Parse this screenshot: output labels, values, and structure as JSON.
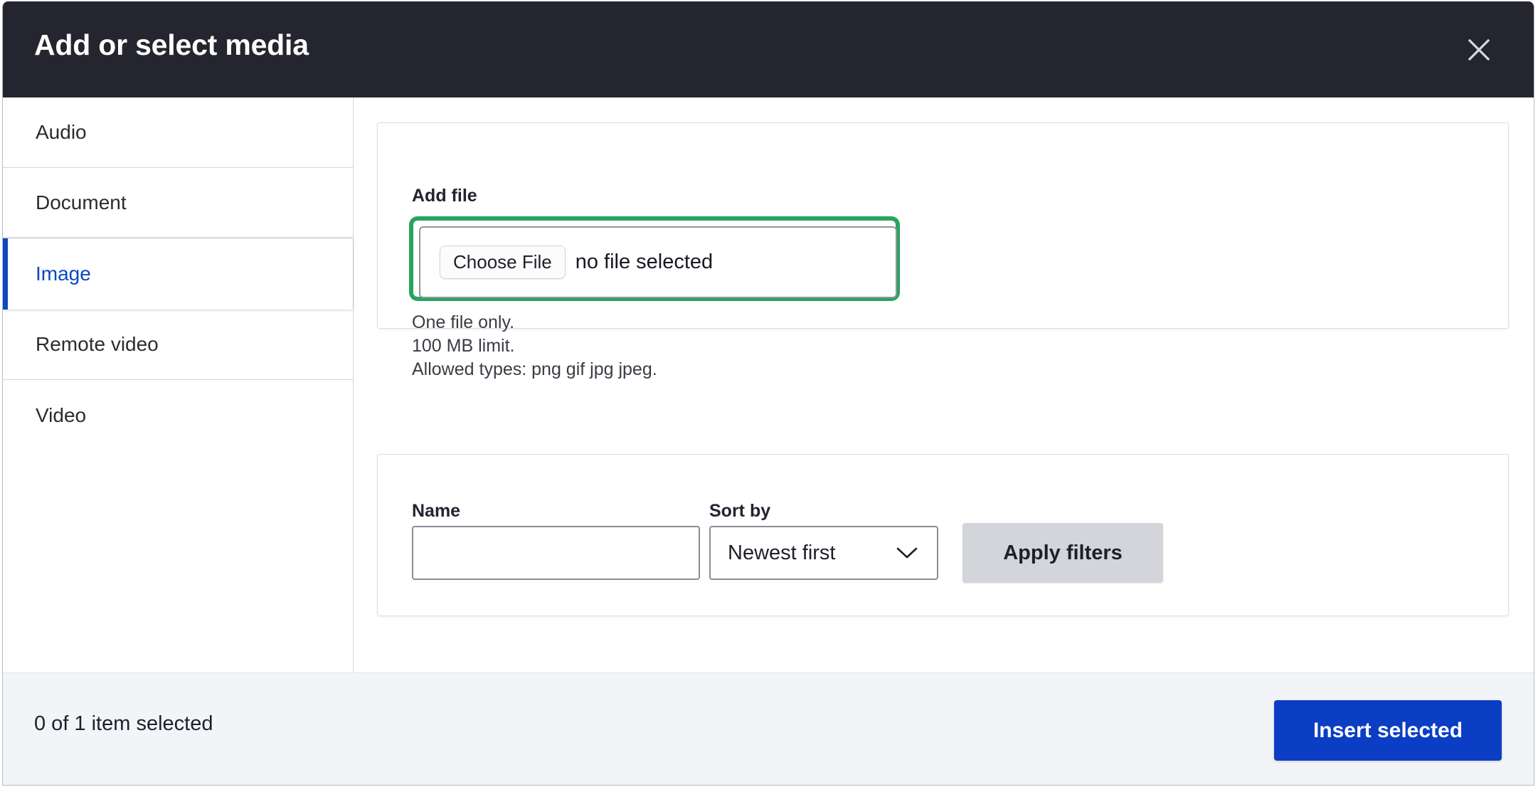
{
  "dialog": {
    "title": "Add or select media",
    "close_icon": "close-icon"
  },
  "sidebar": {
    "items": [
      {
        "label": "Audio",
        "active": false
      },
      {
        "label": "Document",
        "active": false
      },
      {
        "label": "Image",
        "active": true
      },
      {
        "label": "Remote video",
        "active": false
      },
      {
        "label": "Video",
        "active": false
      }
    ]
  },
  "add_file": {
    "label": "Add file",
    "choose_file_button": "Choose File",
    "file_status": "no file selected",
    "hints": [
      "One file only.",
      "100 MB limit.",
      "Allowed types: png gif jpg jpeg."
    ],
    "highlight_color": "#27a45e"
  },
  "filters": {
    "name_label": "Name",
    "name_value": "",
    "name_placeholder": "",
    "sort_label": "Sort by",
    "sort_selected": "Newest first",
    "sort_options": [
      "Newest first"
    ],
    "sort_chevron_icon": "chevron-down-icon",
    "apply_button": "Apply filters"
  },
  "footer": {
    "status": "0 of 1 item selected",
    "insert_button": "Insert selected",
    "insert_button_color": "#0b3ec4"
  }
}
